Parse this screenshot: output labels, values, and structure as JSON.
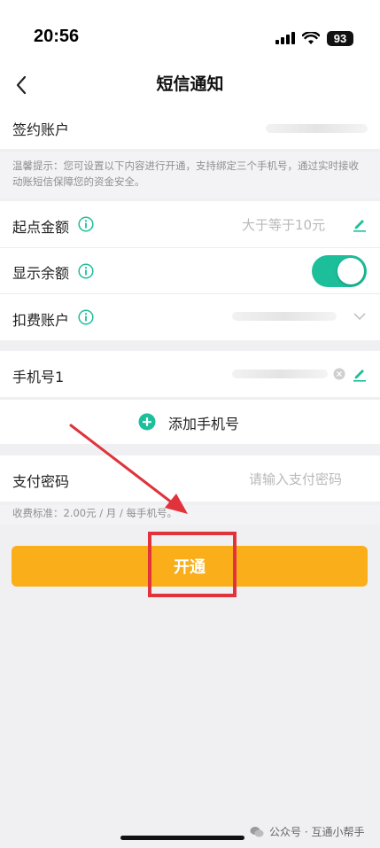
{
  "status_bar": {
    "time": "20:56",
    "battery": "93",
    "icons": [
      "signal-icon",
      "wifi-icon",
      "battery-icon"
    ]
  },
  "nav": {
    "title": "短信通知",
    "back_icon": "chevron-left-icon"
  },
  "account": {
    "label": "签约账户",
    "value_masked": true
  },
  "hint": {
    "text": "温馨提示：您可设置以下内容进行开通，支持绑定三个手机号，通过实时接收动账短信保障您的资金安全。"
  },
  "settings": {
    "threshold": {
      "label": "起点金额",
      "placeholder": "大于等于10元"
    },
    "show_balance": {
      "label": "显示余额",
      "enabled": true
    },
    "deduct_account": {
      "label": "扣费账户",
      "value_masked": true
    }
  },
  "phone": {
    "label": "手机号1",
    "value_masked": true,
    "add_label": "添加手机号"
  },
  "password": {
    "label": "支付密码",
    "placeholder": "请输入支付密码"
  },
  "fee": {
    "text": "收费标准：2.00元 / 月 / 每手机号。"
  },
  "open_button": {
    "label": "开通"
  },
  "watermark": {
    "text": "公众号 · 互通小帮手"
  },
  "colors": {
    "accent_green": "#1dbf9a",
    "button_orange": "#f9ae1a",
    "annotation_red": "#e0333b"
  }
}
